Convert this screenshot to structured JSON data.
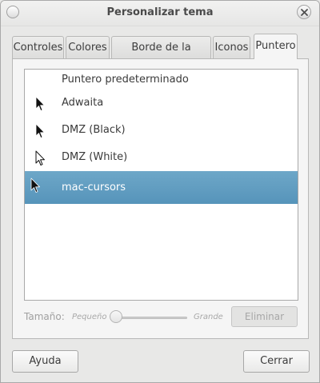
{
  "window": {
    "title": "Personalizar tema"
  },
  "tabs": [
    {
      "label": "Controles"
    },
    {
      "label": "Colores"
    },
    {
      "label": "Borde de la ventana"
    },
    {
      "label": "Iconos"
    },
    {
      "label": "Puntero"
    }
  ],
  "active_tab": "Puntero",
  "cursor_list": [
    {
      "label": "Puntero predeterminado",
      "icon": "none"
    },
    {
      "label": "Adwaita",
      "icon": "black-arrow-cursor-icon"
    },
    {
      "label": "DMZ (Black)",
      "icon": "black-arrow-cursor-icon"
    },
    {
      "label": "DMZ (White)",
      "icon": "white-arrow-cursor-icon"
    },
    {
      "label": "mac-cursors",
      "icon": "black-arrow-cursor-icon",
      "selected": true
    }
  ],
  "size": {
    "label": "Tamaño:",
    "min_label": "Pequeño",
    "max_label": "Grande",
    "value_fraction": 0.0
  },
  "remove_button": {
    "label": "Eliminar",
    "enabled": false
  },
  "footer": {
    "help_label": "Ayuda",
    "close_label": "Cerrar"
  },
  "colors": {
    "selection": "#5e9bbf",
    "window_bg": "#e8e8e7"
  }
}
